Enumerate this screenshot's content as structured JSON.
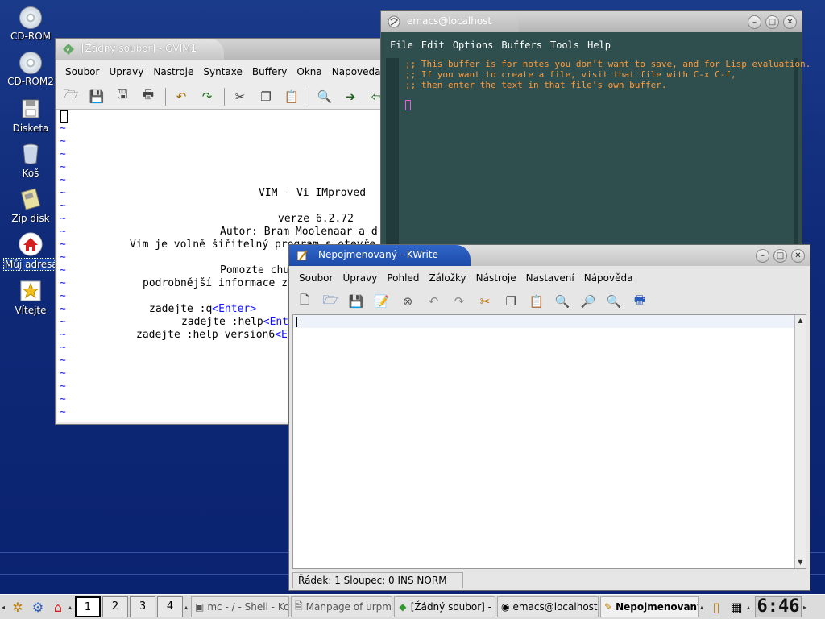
{
  "desktop": {
    "icons": [
      {
        "label": "CD-ROM",
        "icon": "cdrom-icon"
      },
      {
        "label": "CD-ROM2",
        "icon": "cdrom-icon"
      },
      {
        "label": "Disketa",
        "icon": "floppy-icon"
      },
      {
        "label": "Koš",
        "icon": "trash-icon"
      },
      {
        "label": "Zip disk",
        "icon": "zip-disk-icon"
      },
      {
        "label": "Můj adresář",
        "icon": "home-icon"
      },
      {
        "label": "Vítejte",
        "icon": "star-icon"
      }
    ]
  },
  "gvim": {
    "title": "[Žádný soubor] - GVIM1",
    "menu": [
      "Soubor",
      "Upravy",
      "Nastroje",
      "Syntaxe",
      "Buffery",
      "Okna",
      "Napoveda"
    ],
    "splash": {
      "title": "VIM - Vi IMproved",
      "version": "verze 6.2.72",
      "author": "Autor: Bram Moolenaar a d",
      "license": "Vim je volně šiřitelný program s otevře",
      "help_line1": "Pomozte chu",
      "help_line2": "podrobnější informace z",
      "cmd_q_prefix": "zadejte :q",
      "cmd_q_key": "<Enter>",
      "cmd_help_prefix": "zadejte :help",
      "cmd_help_key": "<Ent",
      "cmd_version_prefix": "zadejte :help version6",
      "cmd_version_key": "<E"
    },
    "tilde": "~"
  },
  "emacs": {
    "title": "emacs@localhost",
    "menu": [
      "File",
      "Edit",
      "Options",
      "Buffers",
      "Tools",
      "Help"
    ],
    "lines": [
      ";; This buffer is for notes you don't want to save, and for Lisp evaluation.",
      ";; If you want to create a file, visit that file with C-x C-f,",
      ";; then enter the text in that file's own buffer."
    ]
  },
  "kwrite": {
    "title": "Nepojmenovaný - KWrite",
    "menu": [
      "Soubor",
      "Úpravy",
      "Pohled",
      "Záložky",
      "Nástroje",
      "Nastavení",
      "Nápověda"
    ],
    "status": "Řádek: 1 Sloupec: 0  INS  NORM"
  },
  "taskbar": {
    "desktops": [
      "1",
      "2",
      "3",
      "4"
    ],
    "tasks": [
      {
        "label": "mc - / - Shell - Ko",
        "icon": "terminal-icon"
      },
      {
        "label": "Manpage of urpm",
        "icon": "document-icon"
      },
      {
        "label": "[Žádný soubor] -",
        "icon": "vim-icon"
      },
      {
        "label": "emacs@localhost",
        "icon": "emacs-icon"
      },
      {
        "label": "Nepojmenovaný",
        "icon": "kwrite-icon"
      }
    ],
    "clock": "6:46"
  }
}
